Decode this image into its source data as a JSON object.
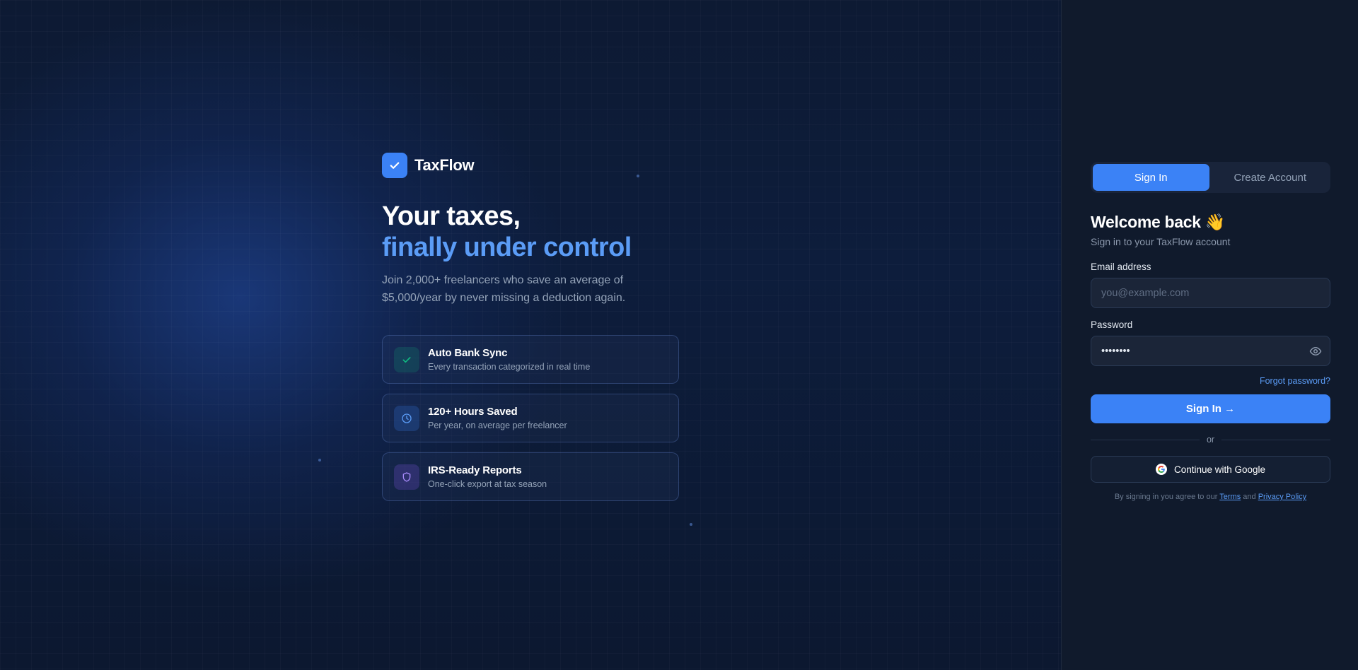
{
  "brand": {
    "name": "TaxFlow"
  },
  "hero": {
    "headline_line1": "Your taxes,",
    "headline_line2": "finally under control",
    "lead": "Join 2,000+ freelancers who save an average of $5,000/year by never missing a deduction again.",
    "features": [
      {
        "icon": "check-icon",
        "title": "Auto Bank Sync",
        "subtitle": "Every transaction categorized in real time",
        "color": "#10b981"
      },
      {
        "icon": "clock-icon",
        "title": "120+ Hours Saved",
        "subtitle": "Per year, on average per freelancer",
        "color": "#3b82f6"
      },
      {
        "icon": "shield-icon",
        "title": "IRS-Ready Reports",
        "subtitle": "One-click export at tax season",
        "color": "#8b5cf6"
      }
    ]
  },
  "auth": {
    "tabs": [
      {
        "label": "Sign In",
        "active": true
      },
      {
        "label": "Create Account",
        "active": false
      }
    ],
    "title": "Welcome back 👋",
    "subtitle": "Sign in to your TaxFlow account",
    "email": {
      "label": "Email address",
      "placeholder": "you@example.com",
      "value": ""
    },
    "password": {
      "label": "Password",
      "value": "••••••••"
    },
    "forgot_label": "Forgot password?",
    "submit_label": "Sign In →",
    "divider_label": "or",
    "google_label": "Continue with Google",
    "legal_prefix": "By signing in you agree to our",
    "legal_terms": "Terms",
    "legal_and": "and",
    "legal_privacy": "Privacy Policy"
  },
  "colors": {
    "accent": "#3b82f6",
    "accent_text": "#5b9cf6",
    "background": "#0c1628",
    "panel": "#101a2c"
  }
}
